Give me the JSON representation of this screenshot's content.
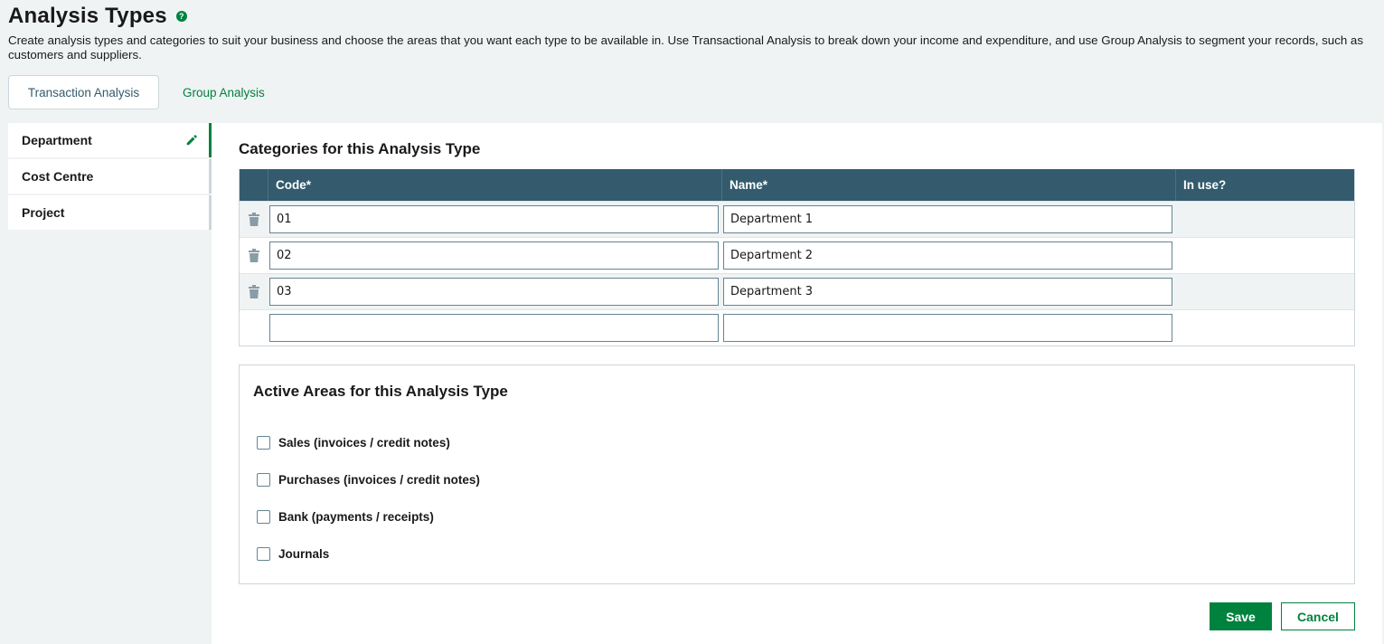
{
  "page": {
    "title": "Analysis Types",
    "help_icon": "question-circle-icon",
    "intro": "Create analysis types and categories to suit your business and choose the areas that you want each type to be available in. Use Transactional Analysis to break down your income and expenditure, and use Group Analysis to segment your records, such as customers and suppliers."
  },
  "tabs": [
    {
      "label": "Transaction Analysis",
      "active": true
    },
    {
      "label": "Group Analysis",
      "active": false
    }
  ],
  "sidebar": {
    "items": [
      {
        "label": "Department",
        "active": true,
        "icon": "pencil-icon"
      },
      {
        "label": "Cost Centre",
        "active": false
      },
      {
        "label": "Project",
        "active": false
      }
    ]
  },
  "categories": {
    "title": "Categories for this Analysis Type",
    "columns": [
      "",
      "Code*",
      "Name*",
      "In use?"
    ],
    "rows": [
      {
        "code": "01",
        "name": "Department 1",
        "in_use": ""
      },
      {
        "code": "02",
        "name": "Department 2",
        "in_use": ""
      },
      {
        "code": "03",
        "name": "Department 3",
        "in_use": ""
      },
      {
        "code": "",
        "name": "",
        "in_use": ""
      }
    ]
  },
  "active_areas": {
    "title": "Active Areas for this Analysis Type",
    "options": [
      {
        "label": "Sales (invoices / credit notes)",
        "checked": false
      },
      {
        "label": "Purchases (invoices / credit notes)",
        "checked": false
      },
      {
        "label": "Bank (payments / receipts)",
        "checked": false
      },
      {
        "label": "Journals",
        "checked": false
      }
    ]
  },
  "actions": {
    "save_label": "Save",
    "cancel_label": "Cancel"
  },
  "colors": {
    "brand_green": "#00823f",
    "header_teal": "#335b6d",
    "background": "#f0f3f4"
  }
}
